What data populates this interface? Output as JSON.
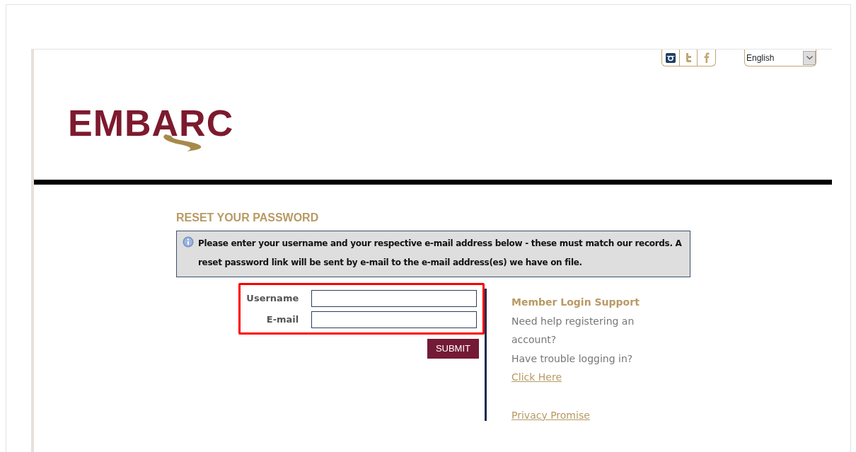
{
  "header": {
    "social_links": [
      {
        "kind": "instagram",
        "selected": true
      },
      {
        "kind": "twitter",
        "selected": false
      },
      {
        "kind": "facebook",
        "selected": false
      }
    ],
    "language": {
      "value": "English"
    },
    "logo": {
      "text": "EMBARC"
    }
  },
  "page": {
    "title": "RESET YOUR PASSWORD",
    "notice": "Please enter your username and your respective e-mail address below - these must match our records. A reset password link will be sent by e-mail to the e-mail address(es) we have on file.",
    "fields": [
      {
        "label": "Username"
      },
      {
        "label": "E-mail"
      }
    ],
    "highlighted": true,
    "submit": "SUBMIT"
  },
  "support": {
    "title": "Member Login Support",
    "lines": [
      {
        "kind": "text",
        "text": "Need help registering an account?"
      },
      {
        "kind": "text",
        "text": "Have trouble logging in?"
      },
      {
        "kind": "link",
        "text": "Click Here"
      },
      {
        "kind": "gap"
      },
      {
        "kind": "link",
        "text": "Privacy Promise"
      }
    ]
  }
}
